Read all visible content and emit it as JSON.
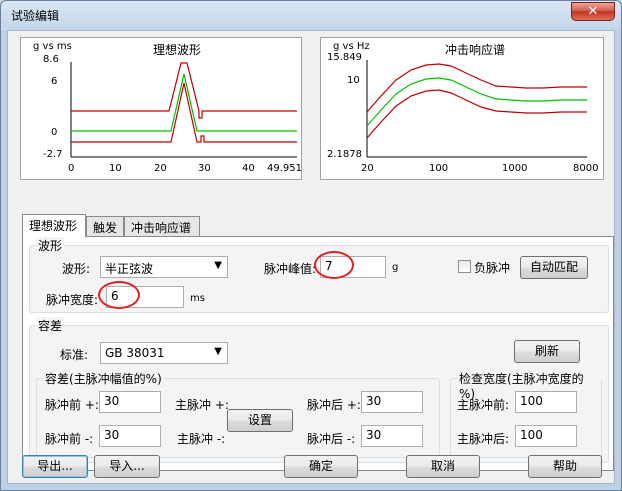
{
  "window": {
    "title": "试验编辑",
    "close_label": "✕"
  },
  "ideal_chart": {
    "title": "理想波形",
    "unit_label": "g vs ms",
    "y_ticks": [
      "8.6",
      "6",
      "0",
      "-2.7"
    ],
    "x_ticks": [
      "0",
      "10",
      "20",
      "30",
      "40",
      "49.951"
    ],
    "colors": {
      "nominal": "#00c000",
      "tolerance": "#c00000"
    }
  },
  "srs_chart": {
    "title": "冲击响应谱",
    "unit_label": "g vs Hz",
    "y_ticks": [
      "15.849",
      "10",
      "2.1878"
    ],
    "x_ticks": [
      "20",
      "100",
      "1000",
      "8000"
    ],
    "colors": {
      "nominal": "#00c000",
      "tolerance": "#c00000"
    }
  },
  "tabs": [
    {
      "label": "理想波形"
    },
    {
      "label": "触发"
    },
    {
      "label": "冲击响应谱"
    }
  ],
  "waveform": {
    "group_title": "波形",
    "shape_label": "波形:",
    "shape_value": "半正弦波",
    "peak_label": "脉冲峰值:",
    "peak_value": "7",
    "peak_unit": "g",
    "negative_label": "负脉冲",
    "negative_checked": false,
    "auto_match_label": "自动匹配",
    "width_label": "脉冲宽度:",
    "width_value": "6",
    "width_unit": "ms"
  },
  "tolerance": {
    "group_title": "容差",
    "standard_label": "标准:",
    "standard_value": "GB 38031",
    "refresh_label": "刷新",
    "sub_title": "容差(主脉冲幅值的%)",
    "pre_plus_label": "脉冲前 +:",
    "pre_plus_value": "30",
    "pre_minus_label": "脉冲前 -:",
    "pre_minus_value": "30",
    "main_plus_label": "主脉冲 +:",
    "main_minus_label": "主脉冲 -:",
    "set_label": "设置",
    "post_plus_label": "脉冲后 +:",
    "post_plus_value": "30",
    "post_minus_label": "脉冲后 -:",
    "post_minus_value": "30",
    "width_check_title": "检查宽度(主脉冲宽度的 %)",
    "main_pre_label": "主脉冲前:",
    "main_pre_value": "100",
    "main_post_label": "主脉冲后:",
    "main_post_value": "100"
  },
  "footer": {
    "export_label": "导出...",
    "import_label": "导入...",
    "ok_label": "确定",
    "cancel_label": "取消",
    "help_label": "帮助"
  }
}
